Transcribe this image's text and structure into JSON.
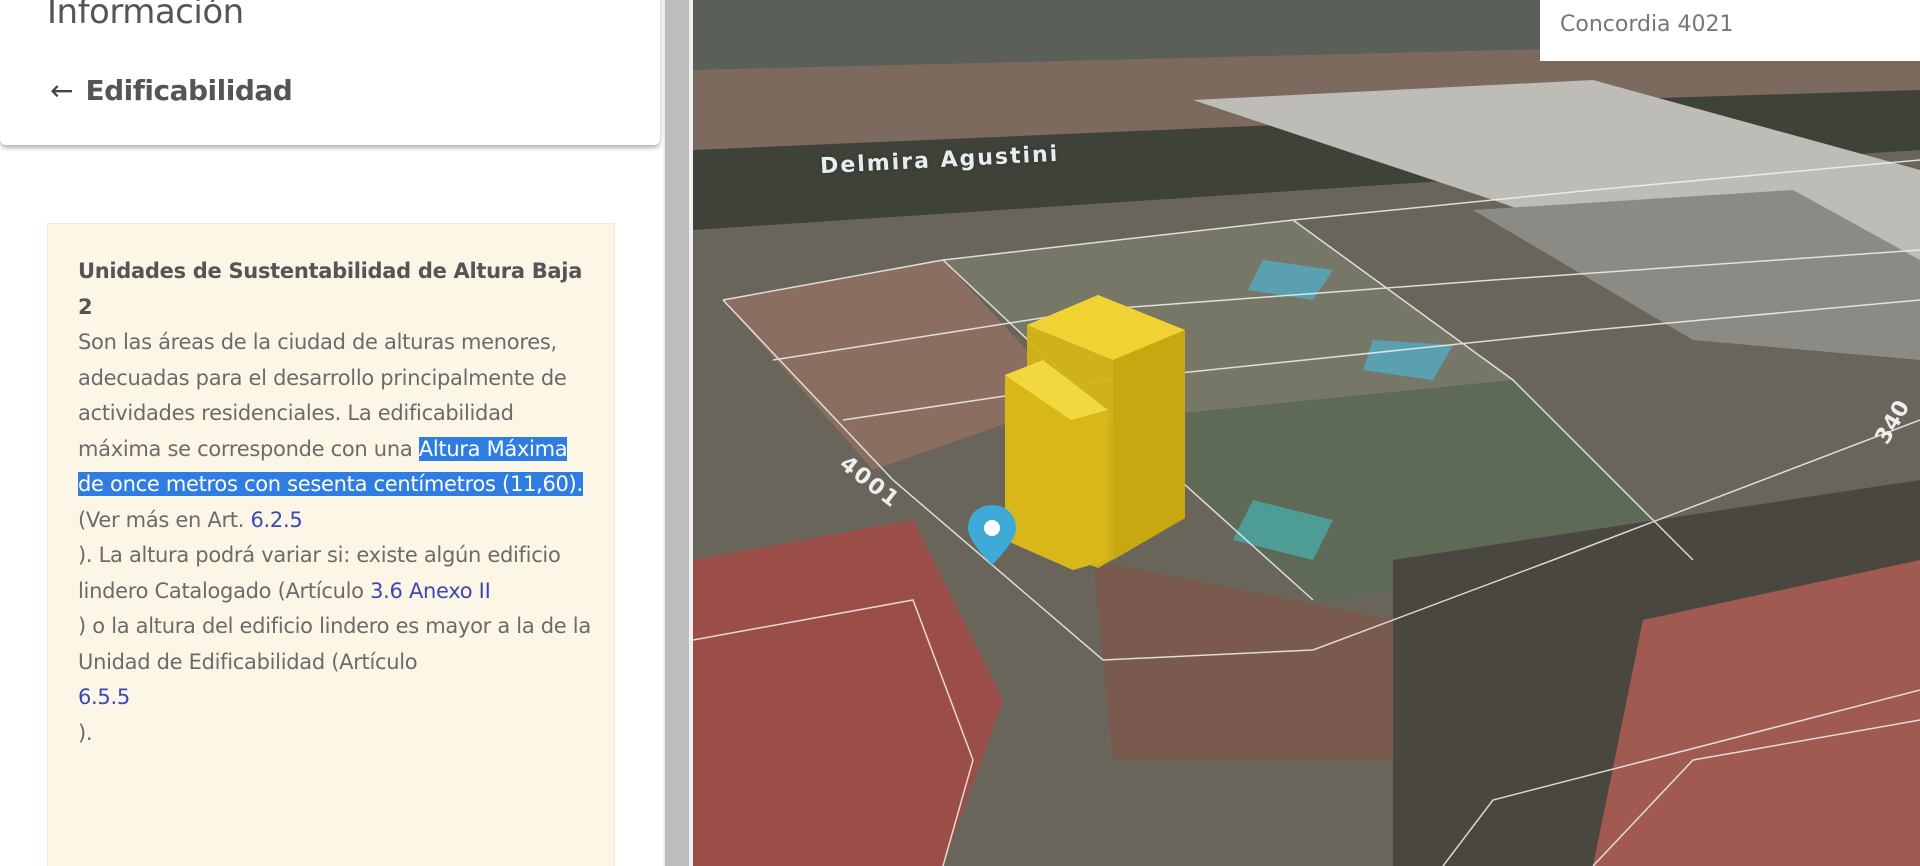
{
  "panel": {
    "title": "Información",
    "back_label": "Edificabilidad",
    "info": {
      "heading": "Unidades de Sustentabilidad de Altura Baja 2",
      "p1": "Son las áreas de la ciudad de alturas menores, adecuadas para el desarrollo principalmente de actividades residenciales. La edificabilidad máxima se corresponde con una ",
      "highlight": "Altura Máxima de once metros con sesenta centímetros (11,60).",
      "p2": " (Ver más en Art. ",
      "link1": "6.2.5",
      "p3": "). La altura podrá variar si: existe algún edificio lindero Catalogado (Artículo ",
      "link2": "3.6 Anexo II",
      "p4": ") o la altura del edificio lindero es mayor a la de la Unidad de Edificabilidad (Artículo ",
      "link3": "6.5.5",
      "p5": ")."
    }
  },
  "map": {
    "search_value": "Concordia 4021",
    "street_label": "Delmira Agustini",
    "parcel_number": "4001",
    "parcel_number_2": "340",
    "building_color": "#e3c21a",
    "pin_color": "#3fa9d8"
  }
}
